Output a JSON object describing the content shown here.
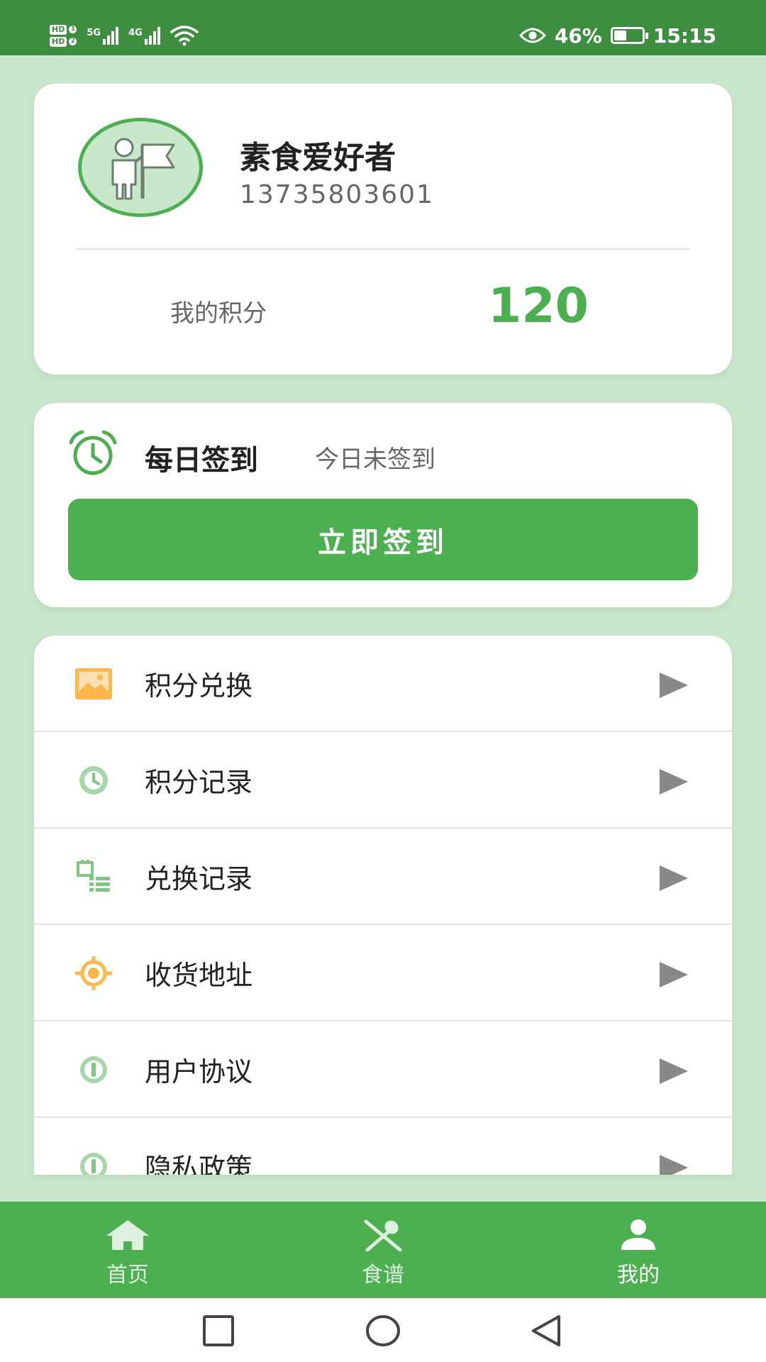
{
  "status_bar": {
    "hd1": "HD",
    "hd1_num": "1",
    "hd2": "HD",
    "hd2_num": "2",
    "net1": "5G",
    "net2": "4G",
    "battery": "46%",
    "battery_level": 0.46,
    "time": "15:15",
    "icons": [
      "signal-icon",
      "wifi-icon",
      "eye-icon",
      "battery-icon"
    ]
  },
  "profile": {
    "name": "素食爱好者",
    "phone": "13735803601",
    "points_label": "我的积分",
    "points_value": "120"
  },
  "checkin": {
    "title": "每日签到",
    "status": "今日未签到",
    "button": "立即签到"
  },
  "menu": [
    {
      "label": "积分兑换",
      "icon": "image-icon"
    },
    {
      "label": "积分记录",
      "icon": "clock-icon"
    },
    {
      "label": "兑换记录",
      "icon": "list-icon"
    },
    {
      "label": "收货地址",
      "icon": "location-icon"
    },
    {
      "label": "用户协议",
      "icon": "info-icon"
    },
    {
      "label": "隐私政策",
      "icon": "info-icon"
    }
  ],
  "nav": [
    {
      "label": "首页",
      "icon": "home-icon"
    },
    {
      "label": "食谱",
      "icon": "utensils-icon"
    },
    {
      "label": "我的",
      "icon": "person-icon"
    }
  ],
  "system_nav": [
    "square-icon",
    "circle-icon",
    "back-triangle-icon"
  ],
  "colors": {
    "primary": "#4caf50",
    "status_bar": "#3d8f3f",
    "background": "#c8e6c9",
    "orange": "#ffb74d",
    "arrow": "#888888"
  }
}
